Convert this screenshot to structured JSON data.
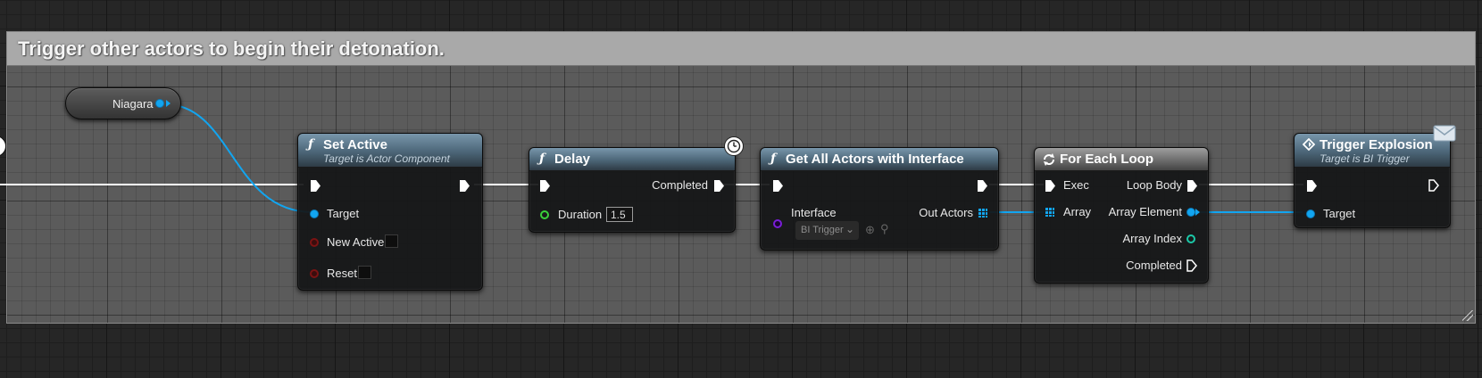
{
  "comment": {
    "title": "Trigger other actors to begin their detonation."
  },
  "variable": {
    "label": "Niagara"
  },
  "set_active": {
    "icon": "function-icon",
    "title": "Set Active",
    "subtitle": "Target is Actor Component",
    "pins": {
      "target": "Target",
      "new_active": "New Active",
      "reset": "Reset"
    }
  },
  "delay": {
    "icon": "function-icon",
    "title": "Delay",
    "pins": {
      "completed": "Completed",
      "duration": "Duration"
    },
    "duration_value": "1.5"
  },
  "get_all_actors": {
    "icon": "function-icon",
    "title": "Get All Actors with Interface",
    "pins": {
      "interface": "Interface",
      "out_actors": "Out Actors"
    },
    "interface_value": "BI Trigger"
  },
  "for_each": {
    "icon": "loop-icon",
    "title": "For Each Loop",
    "pins": {
      "exec": "Exec",
      "array": "Array",
      "loop_body": "Loop Body",
      "array_element": "Array Element",
      "array_index": "Array Index",
      "completed": "Completed"
    }
  },
  "trigger_explosion": {
    "icon": "interface-message-icon",
    "title": "Trigger Explosion",
    "subtitle": "Target is BI Trigger",
    "pins": {
      "target": "Target"
    }
  },
  "colors": {
    "exec_wire": "#ffffff",
    "object_wire": "#12a5f0",
    "float_pin": "#3bd03b",
    "bool_pin": "#7b1313",
    "interface_pin": "#7a1dd8",
    "int_pin": "#1bc9a8"
  }
}
